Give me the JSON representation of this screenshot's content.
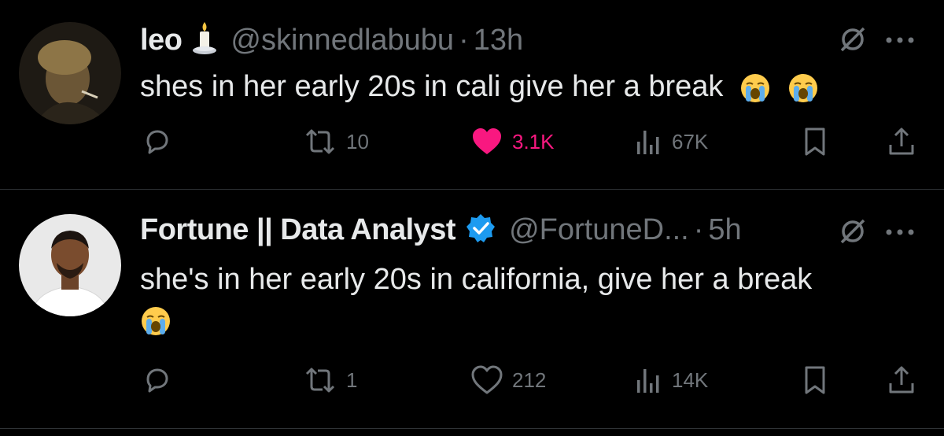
{
  "tweets": [
    {
      "name": "leo",
      "name_emoji": "candle-emoji",
      "handle": "@skinnedlabubu",
      "dot": "·",
      "time": "13h",
      "text": "shes in her early 20s in cali give her a break",
      "trailing_emojis": [
        "loudly-crying-emoji",
        "loudly-crying-emoji"
      ],
      "verified": false,
      "replies": "",
      "retweets": "10",
      "likes": "3.1K",
      "liked": true,
      "views": "67K"
    },
    {
      "name": "Fortune || Data Analyst",
      "verified": true,
      "handle": "@FortuneD...",
      "dot": "·",
      "time": "5h",
      "text": "she's in her early 20s in california, give her a break",
      "trailing_emojis": [
        "loudly-crying-emoji"
      ],
      "replies": "",
      "retweets": "1",
      "likes": "212",
      "liked": false,
      "views": "14K"
    }
  ],
  "colors": {
    "background": "#000000",
    "text": "#e7e9ea",
    "muted": "#71767b",
    "like": "#f91880",
    "verified": "#1d9bf0",
    "divider": "#2f3336"
  }
}
